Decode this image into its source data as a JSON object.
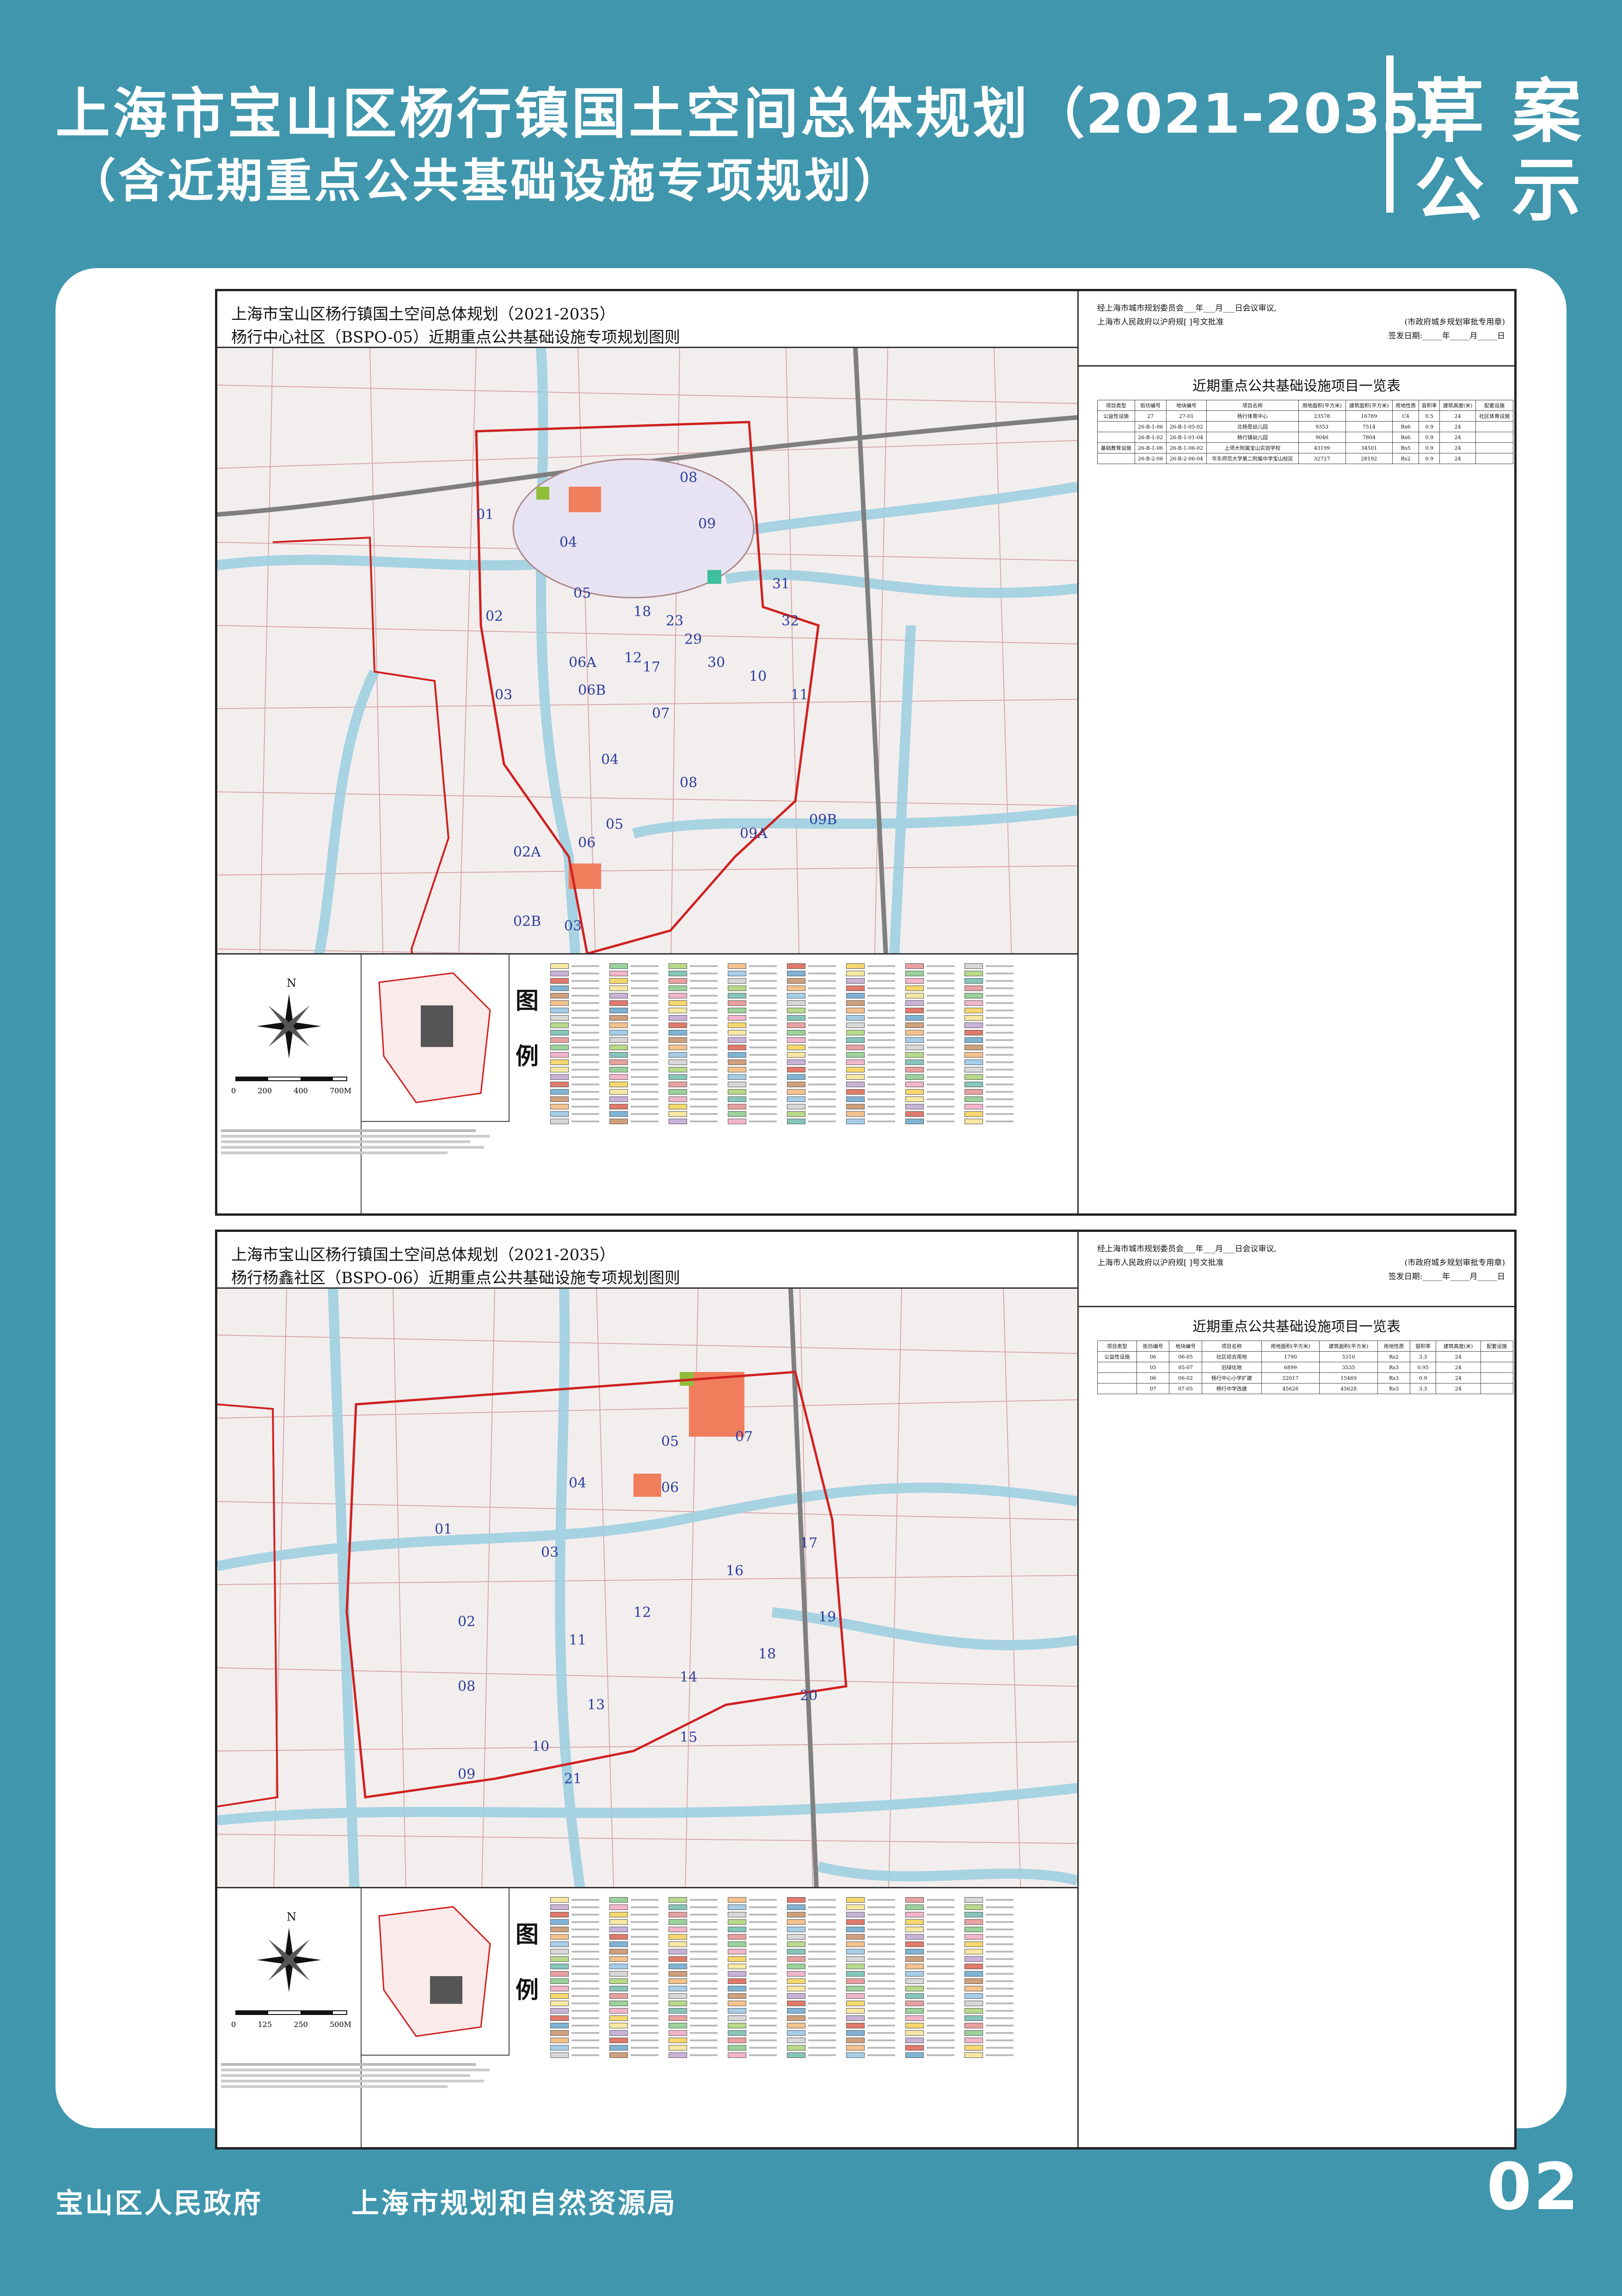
{
  "header": {
    "title": "上海市宝山区杨行镇国土空间总体规划",
    "title_years": "（2021-2035）",
    "subtitle": "（含近期重点公共基础设施专项规划）",
    "badge_line1": "草案",
    "badge_line2": "公示"
  },
  "sheet_a": {
    "title_line1": "上海市宝山区杨行镇国土空间总体规划（2021-2035）",
    "title_line2": "杨行中心社区（BSPO-05）近期重点公共基础设施专项规划图则",
    "approve_line1": "经上海市城市规划委员会___年___月___日会议审议,",
    "approve_line2": "上海市人民政府以沪府规[   ]号文批准",
    "approve_stamp": "(市政府城乡规划审批专用章)",
    "approve_date": "签发日期:_____年_____月_____日",
    "table_title": "近期重点公共基础设施项目一览表",
    "table_headers": [
      "项目类型",
      "街坊编号",
      "地块编号",
      "项目名称",
      "用地面积(平方米)",
      "建筑面积(平方米)",
      "用地性质",
      "容积率",
      "建筑高度(米)",
      "配套设施"
    ],
    "table_rows": [
      [
        "公益性设施",
        "27",
        "27-01",
        "杨行体育中心",
        "23578",
        "16789",
        "C4",
        "0.5",
        "24",
        "社区体育设施"
      ],
      [
        "",
        "26-B-1-06",
        "26-B-1-05-02",
        "北杨思幼儿园",
        "9353",
        "7514",
        "Rs6",
        "0.9",
        "24",
        ""
      ],
      [
        "",
        "26-B-1-02",
        "26-B-1-01-04",
        "杨行镇幼儿园",
        "9046",
        "7804",
        "Rs6",
        "0.9",
        "24",
        ""
      ],
      [
        "基础教育设施",
        "26-B-1-06",
        "26-B-1-06-02",
        "上师大附属宝山实验学校",
        "43199",
        "34501",
        "Rs5",
        "0.9",
        "24",
        ""
      ],
      [
        "",
        "26-B-2-06",
        "26-B-2-06-04",
        "华东师范大学第二附属中学宝山校区",
        "32727",
        "28192",
        "Rs2",
        "0.9",
        "24",
        ""
      ]
    ],
    "scale_labels": [
      "0",
      "200",
      "400",
      "700M"
    ],
    "legend_char1": "图",
    "legend_char2": "例"
  },
  "sheet_b": {
    "title_line1": "上海市宝山区杨行镇国土空间总体规划（2021-2035）",
    "title_line2": "杨行杨鑫社区（BSPO-06）近期重点公共基础设施专项规划图则",
    "approve_line1": "经上海市城市规划委员会___年___月___日会议审议,",
    "approve_line2": "上海市人民政府以沪府规[   ]号文批准",
    "approve_stamp": "(市政府城乡规划审批专用章)",
    "approve_date": "签发日期:_____年_____月_____日",
    "table_title": "近期重点公共基础设施项目一览表",
    "table_headers": [
      "项目类型",
      "街坊编号",
      "地块编号",
      "项目名称",
      "用地面积(平方米)",
      "建筑面积(平方米)",
      "用地性质",
      "容积率",
      "建筑高度(米)",
      "配套设施"
    ],
    "table_rows": [
      [
        "公益性设施",
        "06",
        "06-05",
        "社区综合用地",
        "1790",
        "5310",
        "Rs2",
        "3.3",
        "24",
        ""
      ],
      [
        "",
        "05",
        "05-07",
        "旧绿化地",
        "6899",
        "3535",
        "Rs3",
        "0.95",
        "24",
        ""
      ],
      [
        "",
        "06",
        "06-02",
        "杨行中心小学扩建",
        "22017",
        "15469",
        "Rs3",
        "0.9",
        "24",
        ""
      ],
      [
        "",
        "07",
        "07-05",
        "杨行中学改建",
        "45628",
        "45628",
        "Rs3",
        "3.3",
        "24",
        ""
      ]
    ],
    "scale_labels": [
      "0",
      "125",
      "250",
      "500M"
    ],
    "legend_char1": "图",
    "legend_char2": "例"
  },
  "footer": {
    "left": "宝山区人民政府",
    "mid": "上海市规划和自然资源局",
    "page": "02"
  }
}
